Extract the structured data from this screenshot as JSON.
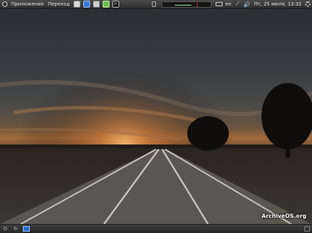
{
  "top_panel": {
    "menu": [
      "Приложения",
      "Переход"
    ],
    "launchers": [
      {
        "name": "mail-icon",
        "color": "#d8d8d8"
      },
      {
        "name": "web-browser-icon",
        "color": "#3a7bd5"
      },
      {
        "name": "screenshot-icon",
        "color": "#cfcfcf"
      },
      {
        "name": "software-center-icon",
        "color": "#6dbf4a"
      },
      {
        "name": "terminal-icon",
        "color": "#1a1a1a"
      }
    ],
    "tray": {
      "keyboard_layout": "en",
      "datetime": "Пт, 25 июля, 13:32"
    }
  },
  "desktop": {
    "watermark": "ArchiveOS.org"
  },
  "bottom_panel": {
    "buttons": [
      "power-icon",
      "refresh-icon",
      "show-desktop-icon"
    ]
  }
}
